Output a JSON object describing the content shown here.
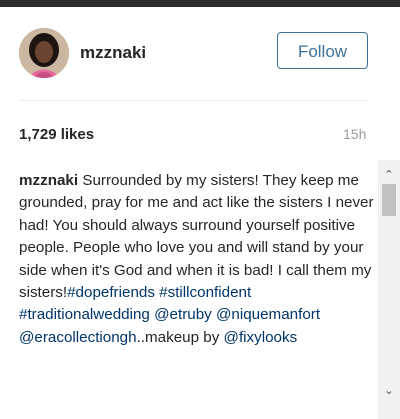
{
  "post": {
    "username": "mzznaki",
    "follow_label": "Follow",
    "likes": "1,729 likes",
    "time": "15h",
    "caption": {
      "username": "mzznaki",
      "text": " Surrounded by my sisters! They keep me grounded, pray for me and act like the sisters I never had! You should always surround yourself positive people. People who love you and will stand by your side when it's God and when it is bad! I call them my sisters!",
      "tag1": "#dopefriends",
      "tag2": "#stillconfident",
      "tag3": "#traditionalwedding",
      "mention1": "@etruby",
      "mention2": "@niquemanfort",
      "mention3": "@eracollectiongh",
      "makeup_text": "..makeup by ",
      "mention4": "@fixylooks"
    }
  },
  "scrollbar": {
    "up_glyph": "⌃",
    "down_glyph": "⌄"
  },
  "colors": {
    "accent": "#3f729b",
    "link": "#003569",
    "muted": "#999999"
  }
}
